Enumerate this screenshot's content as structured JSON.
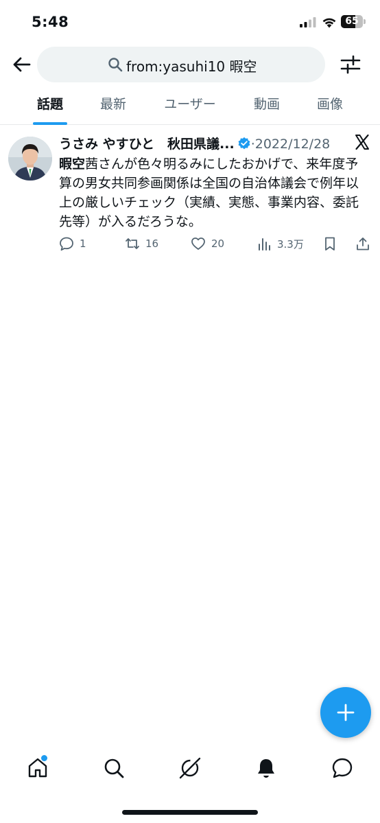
{
  "status_bar": {
    "time": "5:48",
    "battery_level": "65",
    "battery_fraction": 0.65
  },
  "search": {
    "query": "from:yasuhi10 暇空"
  },
  "tabs": [
    {
      "label": "話題",
      "active": true
    },
    {
      "label": "最新",
      "active": false
    },
    {
      "label": "ユーザー",
      "active": false
    },
    {
      "label": "動画",
      "active": false
    },
    {
      "label": "画像",
      "active": false
    }
  ],
  "tweet": {
    "author_name": "うさみ やすひと　秋田県議...",
    "separator": "·",
    "date": "2022/12/28",
    "highlight": "暇空",
    "text": "茜さんが色々明るみにしたおかげで、来年度予算の男女共同参画関係は全国の自治体議会で例年以上の厳しいチェック（実績、実態、事業内容、委託先等）が入るだろうな。",
    "replies": "1",
    "retweets": "16",
    "likes": "20",
    "views": "3.3万"
  },
  "colors": {
    "accent": "#1d9bf0",
    "text_primary": "#0f1419",
    "text_secondary": "#536471",
    "search_bg": "#eff3f4"
  },
  "icons": {
    "back": "arrow-left-icon",
    "search": "search-icon",
    "filter": "sliders-icon",
    "verified": "verified-badge-icon",
    "x_logo": "x-logo-icon",
    "reply": "reply-icon",
    "retweet": "retweet-icon",
    "like": "heart-icon",
    "views": "views-icon",
    "bookmark": "bookmark-icon",
    "share": "share-icon",
    "compose": "plus-icon",
    "nav_home": "home-icon",
    "nav_search": "search-icon",
    "nav_grok": "grok-icon",
    "nav_notifications": "bell-icon",
    "nav_messages": "message-icon"
  }
}
